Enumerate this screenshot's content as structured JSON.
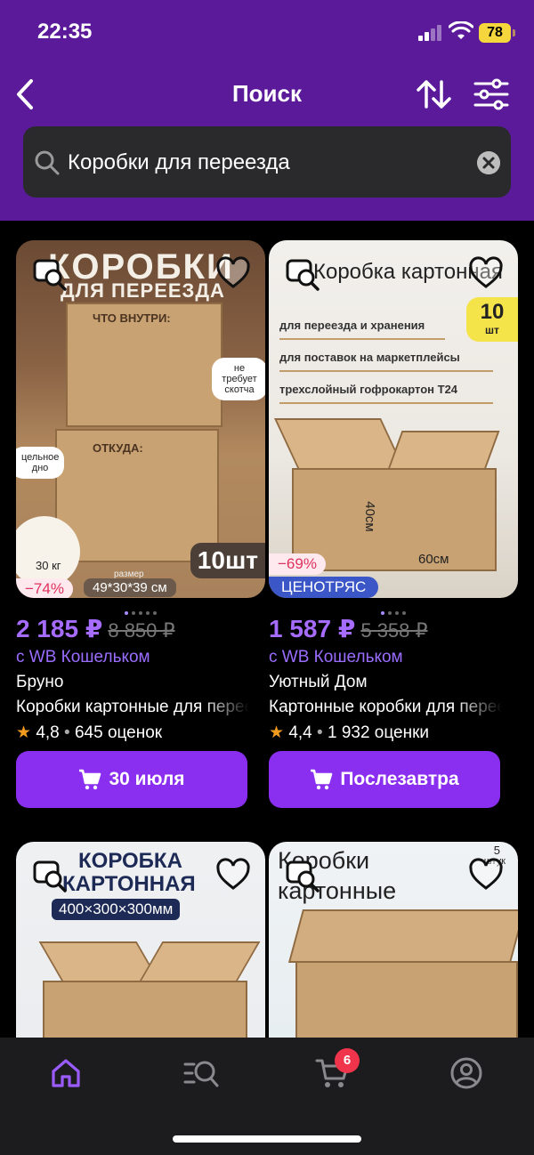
{
  "status_bar": {
    "time": "22:35",
    "battery": "78"
  },
  "header": {
    "title": "Поиск"
  },
  "search": {
    "query": "Коробки для переезда"
  },
  "products": [
    {
      "image_headline": "КОРОБКИ",
      "image_subheadline": "ДЛЯ ПЕРЕЕЗДА",
      "image_texts": [
        "ЧТО ВНУТРИ:",
        "ОТКУДА:",
        "не требует скотча",
        "цельное дно",
        "30 кг",
        "размер",
        "49*30*39 см",
        "10шт"
      ],
      "discount": "−74%",
      "promo": "",
      "price": "2 185 ₽",
      "old_price": "8 850 ₽",
      "wallet": "с WB Кошельком",
      "brand": "Бруно",
      "title": "Коробки картонные для переезда",
      "rating": "4,8",
      "reviews": "645 оценок",
      "delivery": "30 июля"
    },
    {
      "image_headline": "Коробка картонная",
      "image_texts": [
        "для переезда и хранения",
        "для поставок на маркетплейсы",
        "трехслойный гофрокартон Т24",
        "40см",
        "60см"
      ],
      "qty_badge_num": "10",
      "qty_badge_unit": "шт",
      "discount": "−69%",
      "promo": "ЦЕНОТРЯС",
      "price": "1 587 ₽",
      "old_price": "5 358 ₽",
      "wallet": "с WB Кошельком",
      "brand": "Уютный Дом",
      "title": "Картонные коробки для переезда",
      "rating": "4,4",
      "reviews": "1 932 оценки",
      "delivery": "Послезавтра"
    },
    {
      "image_headline": "КОРОБКА",
      "image_subheadline": "КАРТОННАЯ",
      "image_size": "400×300×300мм"
    },
    {
      "image_headline": "Коробки",
      "image_subheadline": "картонные",
      "corner_num": "5",
      "corner_unit": "штук"
    }
  ],
  "tabbar": {
    "cart_count": "6"
  },
  "colors": {
    "header": "#5b1a9a",
    "accent": "#8a2ef0",
    "price": "#a66cff",
    "discount": "#e0315d"
  }
}
